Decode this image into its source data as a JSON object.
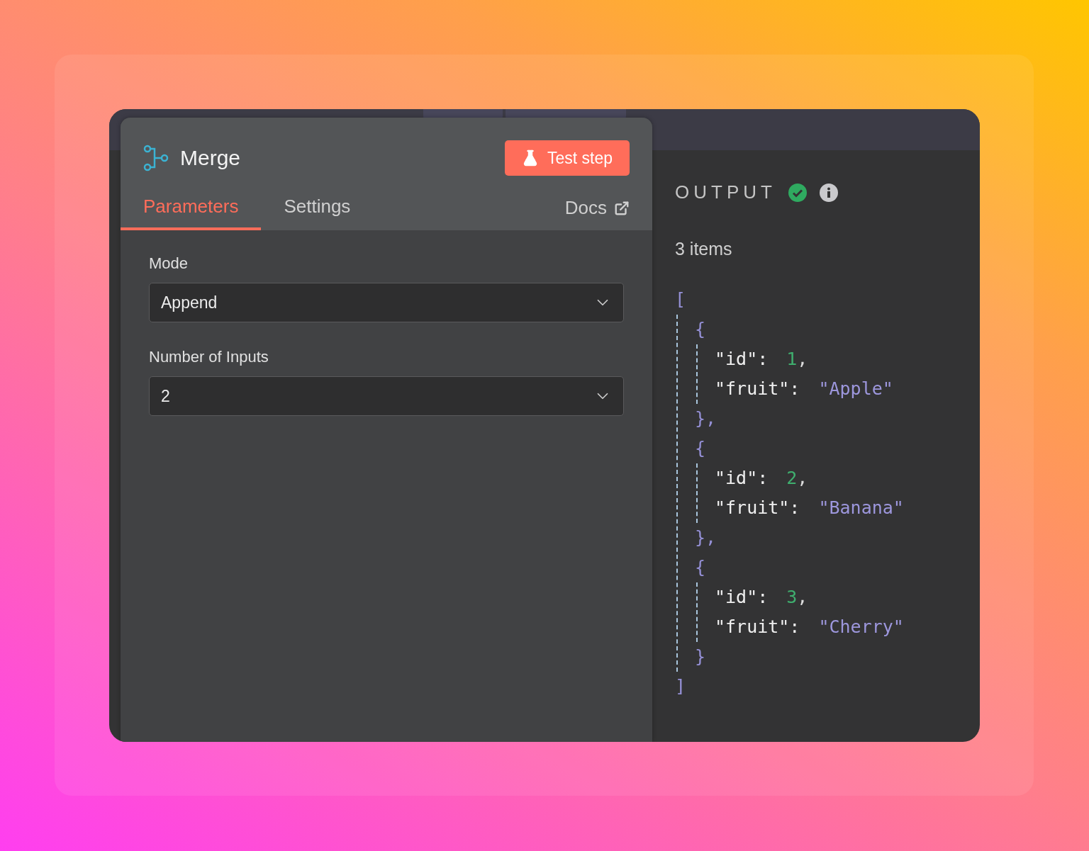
{
  "node": {
    "title": "Merge",
    "test_button": "Test step"
  },
  "tabs": [
    {
      "label": "Parameters",
      "selected": true
    },
    {
      "label": "Settings",
      "selected": false
    }
  ],
  "docs_link": "Docs",
  "parameters": [
    {
      "label": "Mode",
      "value": "Append"
    },
    {
      "label": "Number of Inputs",
      "value": "2"
    }
  ],
  "output": {
    "title": "OUTPUT",
    "success": true,
    "count": "3 items",
    "open": "[",
    "close": "]",
    "items": [
      {
        "open": "{",
        "close": "},",
        "fields": [
          {
            "key": "\"id\":",
            "value": "1",
            "kind": "number",
            "comma": ","
          },
          {
            "key": "\"fruit\":",
            "value": "\"Apple\"",
            "kind": "string"
          }
        ]
      },
      {
        "open": "{",
        "close": "},",
        "fields": [
          {
            "key": "\"id\":",
            "value": "2",
            "kind": "number",
            "comma": ","
          },
          {
            "key": "\"fruit\":",
            "value": "\"Banana\"",
            "kind": "string"
          }
        ]
      },
      {
        "open": "{",
        "close": "}",
        "fields": [
          {
            "key": "\"id\":",
            "value": "3",
            "kind": "number",
            "comma": ","
          },
          {
            "key": "\"fruit\":",
            "value": "\"Cherry\"",
            "kind": "string"
          }
        ]
      }
    ]
  }
}
